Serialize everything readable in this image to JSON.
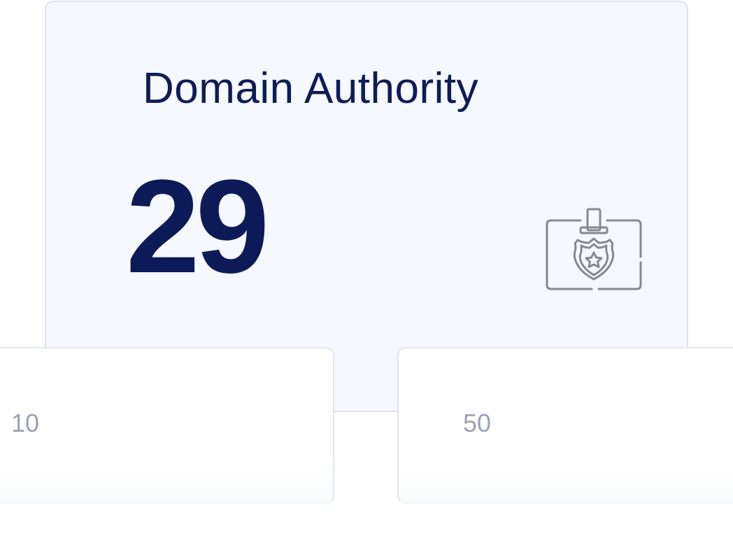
{
  "metric_card": {
    "title": "Domain Authority",
    "value": "29",
    "icon": "id-badge-icon"
  },
  "range_cards": [
    {
      "value": "10"
    },
    {
      "value": "50"
    }
  ],
  "colors": {
    "card_background": "#f5f8fe",
    "title_text": "#0e1c57",
    "value_text": "#0c1b58",
    "muted_text": "#9ba2b6",
    "icon_stroke": "#85898f",
    "border": "#e1e4ea"
  }
}
